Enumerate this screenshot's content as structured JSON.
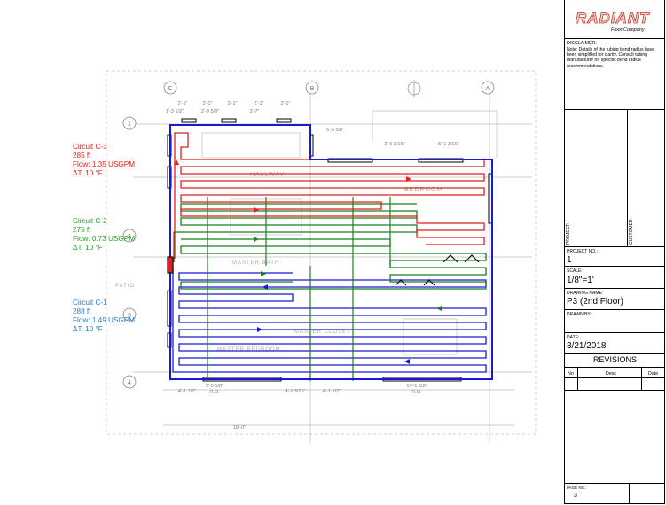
{
  "circuits": [
    {
      "name": "Circuit C-3",
      "length": "285 ft",
      "flow": "Flow: 1.35 USGPM",
      "delta": "ΔT: 10 °F",
      "color": "#e41e1e"
    },
    {
      "name": "Circuit C-2",
      "length": "275 ft",
      "flow": "Flow: 0.73 USGPM",
      "delta": "ΔT: 10 °F",
      "color": "#2a9d2a"
    },
    {
      "name": "Circuit C-1",
      "length": "288 ft",
      "flow": "Flow: 1.49 USGPM",
      "delta": "ΔT: 10 °F",
      "color": "#2d7bc4"
    }
  ],
  "plan": {
    "grid_top": [
      "C",
      "B",
      "A"
    ],
    "grid_side": [
      "1",
      "2",
      "3",
      "4"
    ],
    "room_labels": [
      "HALLWAY",
      "BEDROOM",
      "MASTER BATH",
      "MASTER BEDROOM",
      "MASTER CLOSET",
      "PATIO"
    ],
    "dims_top": [
      "2'-1\"",
      "2'-1\"",
      "2'-1\"",
      "2'-1\"",
      "2'-1\"",
      "5'-5 5/8\"",
      "3'-7\"",
      "1'-3 1/2\"",
      "2'-9 5/8\"",
      "2'-5 3/16\"",
      "5'-1 3/16\""
    ],
    "dims_bottom": [
      "5'-5 5/8\"",
      "R.O.",
      "4'-1 1/2\"",
      "4'-1 3/16\"",
      "4'-1 1/2\"",
      "10'-1 5/8\"",
      "R.O.",
      "18'-0\""
    ]
  },
  "titleblock": {
    "logo_word": "RADIANT",
    "logo_sub": "Floor Company",
    "disclaimer_label": "DISCLAIMER:",
    "disclaimer_text": "Note: Details of the tubing bend radius have been simplified for clarity. Consult tubing manufacturer for specific bend radius recommendations.",
    "project_label": "PROJECT:",
    "customer_label": "CUSTOMER:",
    "project_no_label": "PROJECT NO.:",
    "project_no": "1",
    "scale_label": "SCALE:",
    "scale": "1/8\"=1'",
    "drawing_name_label": "DRAWING NAME:",
    "drawing_name": "P3 (2nd Floor)",
    "drawn_by_label": "DRAWN BY:",
    "date_label": "DATE:",
    "date": "3/21/2018",
    "revisions_title": "REVISIONS",
    "rev_no": "No",
    "rev_desc": "Desc",
    "rev_date": "Date",
    "page_no_label": "PAGE NO.:",
    "page_no": "3"
  },
  "colors": {
    "supply_main": "#1a1ad6",
    "c1": "#2d7bc4",
    "c2": "#2a9d2a",
    "c3": "#e41e1e",
    "wall": "#9a9a9a"
  }
}
